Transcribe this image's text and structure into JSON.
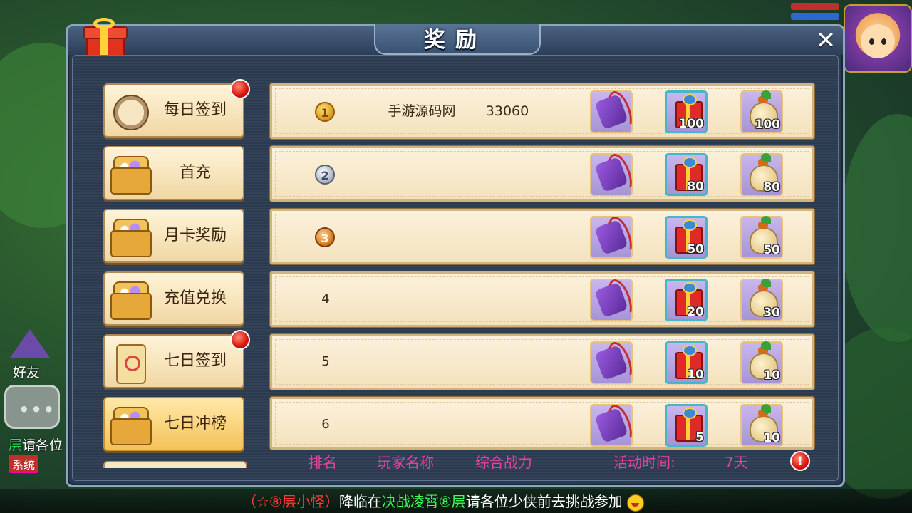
{
  "background": {
    "friend_label": "好友",
    "chat_fragment_prefix": "层",
    "chat_fragment_rest": "请各位",
    "chat_tag": "系统"
  },
  "marquee": {
    "part1": "（☆⑧层小怪）",
    "part2": "降临在",
    "part3": "决战凌霄⑧层",
    "part4": "请各位少侠前去挑战参加"
  },
  "dialog": {
    "title": "奖励",
    "close_label": "✕"
  },
  "sidebar": [
    {
      "label": "每日签到",
      "icon": "scroll-icon",
      "badge": true,
      "active": false
    },
    {
      "label": "首充",
      "icon": "treasure-chest-icon",
      "badge": false,
      "active": false
    },
    {
      "label": "月卡奖励",
      "icon": "treasure-chest-icon",
      "badge": false,
      "active": false
    },
    {
      "label": "充值兑换",
      "icon": "treasure-chest-icon",
      "badge": false,
      "active": false
    },
    {
      "label": "七日签到",
      "icon": "treasure-map-icon",
      "badge": true,
      "active": false
    },
    {
      "label": "七日冲榜",
      "icon": "treasure-chest-icon",
      "badge": false,
      "active": true
    }
  ],
  "rows": [
    {
      "rank": "1",
      "medal": "gold",
      "player": "手游源码网",
      "power": "33060",
      "gift_count": "100",
      "bag_count": "100"
    },
    {
      "rank": "2",
      "medal": "silver",
      "player": "",
      "power": "",
      "gift_count": "80",
      "bag_count": "80"
    },
    {
      "rank": "3",
      "medal": "bronze",
      "player": "",
      "power": "",
      "gift_count": "50",
      "bag_count": "50"
    },
    {
      "rank": "4",
      "medal": "",
      "player": "",
      "power": "",
      "gift_count": "20",
      "bag_count": "30"
    },
    {
      "rank": "5",
      "medal": "",
      "player": "",
      "power": "",
      "gift_count": "10",
      "bag_count": "10"
    },
    {
      "rank": "6",
      "medal": "",
      "player": "",
      "power": "",
      "gift_count": "5",
      "bag_count": "10"
    }
  ],
  "footer": {
    "col_rank": "排名",
    "col_player": "玩家名称",
    "col_power": "综合战力",
    "activity_time_label": "活动时间:",
    "activity_time_value": "7天",
    "info_icon": "!"
  },
  "colors": {
    "footer_text": "#e0449e",
    "badge_red": "#d8140a",
    "row_bg": "#f4e2bd",
    "dialog_bg": "#2a3a50"
  }
}
